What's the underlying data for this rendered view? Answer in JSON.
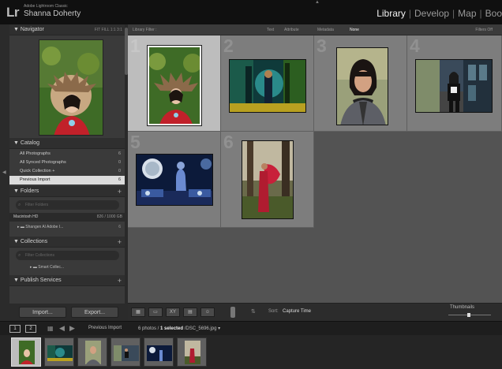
{
  "app": {
    "logo": "Lr",
    "subtitle": "Adobe Lightroom Classic",
    "user": "Shanna Doherty"
  },
  "modules": [
    "Library",
    "Develop",
    "Map",
    "Boo"
  ],
  "navigator": {
    "title": "Navigator",
    "zoom_labels": "FIT  FILL  1:1  3:1"
  },
  "catalog": {
    "title": "Catalog",
    "items": [
      {
        "label": "All Photographs",
        "count": "6"
      },
      {
        "label": "All Synced Photographs",
        "count": "0"
      },
      {
        "label": "Quick Collection +",
        "count": "0"
      },
      {
        "label": "Previous Import",
        "count": "6"
      }
    ]
  },
  "folders": {
    "title": "Folders",
    "filter_placeholder": "Filter Folders",
    "volume": "Macintosh HD",
    "volume_info": "826 / 1000 GB",
    "folder": "Shangen Al Adobe I...",
    "folder_count": "6"
  },
  "collections": {
    "title": "Collections",
    "filter_placeholder": "Filter Collections",
    "item": "Smart Collec..."
  },
  "publish": {
    "title": "Publish Services"
  },
  "buttons": {
    "import": "Import...",
    "export": "Export..."
  },
  "filterbar": {
    "title": "Library Filter :",
    "options": [
      "Text",
      "Attribute",
      "Metadata",
      "None"
    ],
    "active": "None",
    "filters_off": "Filters Off"
  },
  "grid": {
    "cells": [
      {
        "num": "1",
        "selected": true
      },
      {
        "num": "2",
        "selected": false
      },
      {
        "num": "3",
        "selected": false
      },
      {
        "num": "4",
        "selected": false
      },
      {
        "num": "5",
        "selected": false
      },
      {
        "num": "6",
        "selected": false
      }
    ]
  },
  "toolbar": {
    "sort_label": "Sort:",
    "sort_value": "Capture Time",
    "thumbnails_label": "Thumbnails"
  },
  "filmstrip": {
    "source": "Previous Import",
    "count_prefix": "6 photos /",
    "selected": "1 selected",
    "file": "/DSC_5696.jpg",
    "monitors": [
      "1",
      "2"
    ]
  },
  "colors": {
    "selected_cell": "#bdbdbd",
    "cell": "#7d7d7d",
    "grid_bg": "#535353",
    "panel_bg": "#3a3a3a"
  }
}
